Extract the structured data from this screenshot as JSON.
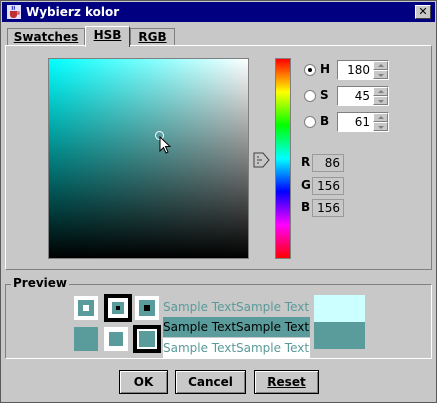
{
  "window": {
    "title": "Wybierz kolor",
    "close_glyph": "✕"
  },
  "tabs": [
    {
      "label": "Swatches",
      "mnemonic": "S",
      "active": false
    },
    {
      "label": "HSB",
      "mnemonic": "H",
      "active": true
    },
    {
      "label": "RGB",
      "mnemonic": "G",
      "active": false
    }
  ],
  "hsb": {
    "selected": "H",
    "rows": [
      {
        "label": "H",
        "value": "180",
        "checked": true
      },
      {
        "label": "S",
        "value": "45",
        "checked": false
      },
      {
        "label": "B",
        "value": "61",
        "checked": false
      }
    ]
  },
  "rgb": [
    {
      "label": "R",
      "value": "86"
    },
    {
      "label": "G",
      "value": "156"
    },
    {
      "label": "B",
      "value": "156"
    }
  ],
  "preview": {
    "label": "Preview",
    "sample_text": "Sample Text",
    "colors": {
      "selected": "#5a9c9c",
      "light": "#ccffff"
    }
  },
  "buttons": {
    "ok": "OK",
    "cancel": "Cancel",
    "reset": "Reset"
  },
  "icons": {
    "title": "java-cup-icon",
    "cursor": "mouse-pointer-icon",
    "hue": "hue-slider-arrow-icon"
  }
}
